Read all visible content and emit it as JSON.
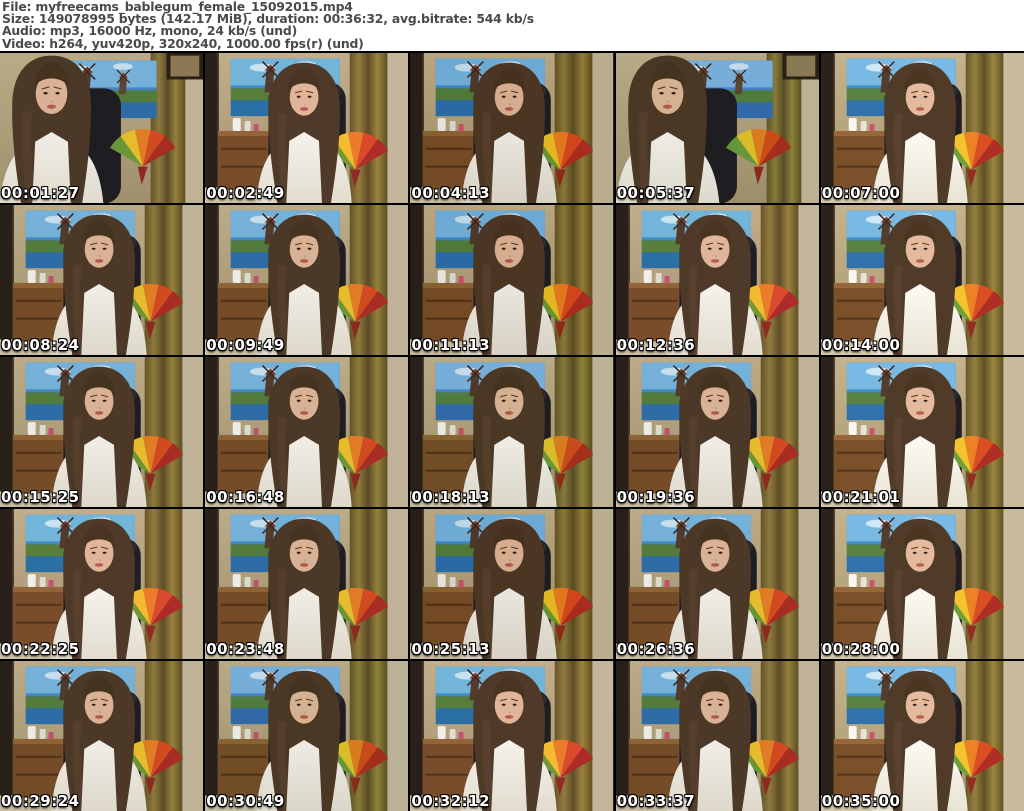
{
  "header": {
    "lines": [
      "File: myfreecams_bablegum_female_15092015.mp4",
      "Size: 149078995 bytes (142.17 MiB), duration: 00:36:32, avg.bitrate: 544 kb/s",
      "Audio: mp3, 16000 Hz, mono, 24 kb/s (und)",
      "Video: h264, yuv420p, 320x240, 1000.00 fps(r) (und)"
    ],
    "text_color": "#4a4a4a",
    "background": "#ffffff"
  },
  "grid": {
    "rows": 5,
    "cols": 5,
    "gap_color": "#000000",
    "cells": [
      {
        "timestamp": "00:01:27"
      },
      {
        "timestamp": "00:02:49"
      },
      {
        "timestamp": "00:04:13"
      },
      {
        "timestamp": "00:05:37"
      },
      {
        "timestamp": "00:07:00"
      },
      {
        "timestamp": "00:08:24"
      },
      {
        "timestamp": "00:09:49"
      },
      {
        "timestamp": "00:11:13"
      },
      {
        "timestamp": "00:12:36"
      },
      {
        "timestamp": "00:14:00"
      },
      {
        "timestamp": "00:15:25"
      },
      {
        "timestamp": "00:16:48"
      },
      {
        "timestamp": "00:18:13"
      },
      {
        "timestamp": "00:19:36"
      },
      {
        "timestamp": "00:21:01"
      },
      {
        "timestamp": "00:22:25"
      },
      {
        "timestamp": "00:23:48"
      },
      {
        "timestamp": "00:25:13"
      },
      {
        "timestamp": "00:26:36"
      },
      {
        "timestamp": "00:28:00"
      },
      {
        "timestamp": "00:29:24"
      },
      {
        "timestamp": "00:30:49"
      },
      {
        "timestamp": "00:32:12"
      },
      {
        "timestamp": "00:33:37"
      },
      {
        "timestamp": "00:35:00"
      }
    ]
  },
  "scene": {
    "description": "webcam room: person with long brown hair in white t-shirt, tan wall, blue windmill painting, black office chair, rainbow umbrella, olive-brown curtain, wooden dresser",
    "colors": {
      "wall": "#b3a37e",
      "painting_blue": "#4285c0",
      "curtain": "#7c6a38",
      "chair": "#1e1d22",
      "hair": "#4c3827",
      "skin": "#d9b295",
      "shirt": "#eeebe2",
      "umbrella": [
        "#6b9638",
        "#e6bb2c",
        "#e07c25",
        "#d14a22",
        "#a72d22"
      ],
      "timestamp_text": "#ffffff"
    }
  }
}
